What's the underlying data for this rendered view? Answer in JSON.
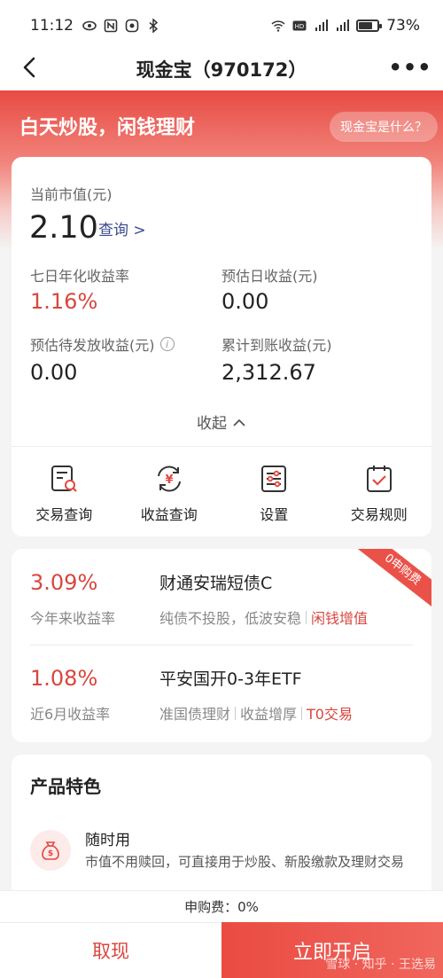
{
  "status_bar": {
    "time": "11:12",
    "battery": "73%",
    "battery_level": 0.73
  },
  "nav": {
    "title": "现金宝（970172）",
    "more": "•••"
  },
  "hero": {
    "title": "白天炒股，闲钱理财",
    "faq": "现金宝是什么？"
  },
  "summary": {
    "market_value_label": "当前市值(元)",
    "market_value": "2.10",
    "query_link": "查询 >",
    "seven_day_label": "七日年化收益率",
    "seven_day_value": "1.16%",
    "daily_est_label": "预估日收益(元)",
    "daily_est_value": "0.00",
    "pending_label": "预估待发放收益(元)",
    "pending_value": "0.00",
    "accum_label": "累计到账收益(元)",
    "accum_value": "2,312.67",
    "collapse": "收起"
  },
  "actions": [
    {
      "label": "交易查询",
      "icon": "receipt-search-icon"
    },
    {
      "label": "收益查询",
      "icon": "yuan-refresh-icon"
    },
    {
      "label": "设置",
      "icon": "settings-sliders-icon"
    },
    {
      "label": "交易规则",
      "icon": "clipboard-check-icon"
    }
  ],
  "funds": {
    "ribbon": "0申购费",
    "items": [
      {
        "rate": "3.09%",
        "rate_label": "今年来收益率",
        "name": "财通安瑞短债C",
        "tag1": "纯债不投股，低波安稳",
        "tag2": "闲钱增值"
      },
      {
        "rate": "1.08%",
        "rate_label": "近6月收益率",
        "name": "平安国开0-3年ETF",
        "tag1": "准国债理财",
        "tag2": "收益增厚",
        "tag3": "T0交易"
      }
    ]
  },
  "features": {
    "title": "产品特色",
    "item_title": "随时用",
    "item_desc": "市值不用赎回，可直接用于炒股、新股缴款及理财交易"
  },
  "fee": "申购费：0%",
  "buttons": {
    "withdraw": "取现",
    "open": "立即开启"
  },
  "watermark": "雪球 · 知乎 · 王选易"
}
